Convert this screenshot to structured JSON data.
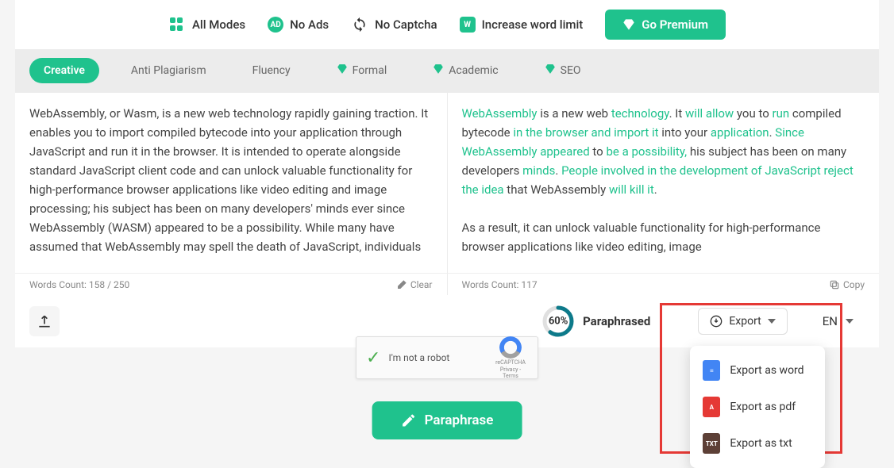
{
  "topbar": {
    "all_modes": "All Modes",
    "no_ads": "No Ads",
    "no_captcha": "No Captcha",
    "word_limit": "Increase word limit",
    "premium": "Go Premium"
  },
  "tabs": {
    "creative": "Creative",
    "anti_plagiarism": "Anti Plagiarism",
    "fluency": "Fluency",
    "formal": "Formal",
    "academic": "Academic",
    "seo": "SEO"
  },
  "input_text": {
    "full": "WebAssembly, or Wasm, is a new web technology rapidly gaining traction. It enables you to import compiled bytecode into your application through JavaScript and run it in the browser. It is intended to operate alongside standard JavaScript client code and can unlock valuable functionality for high-performance browser applications like video editing and image processing; his subject has been on many developers' minds ever since WebAssembly (WASM) appeared to be a possibility. While many have assumed that WebAssembly may spell the death of JavaScript, individuals"
  },
  "output_text": {
    "p1_seg1": "WebAssembly",
    "p1_seg2": " is a new web ",
    "p1_seg3": "technology",
    "p1_seg4": ". It ",
    "p1_seg5": "will allow",
    "p1_seg6": " you to ",
    "p1_seg7": "run",
    "p1_seg8": " compiled bytecode ",
    "p1_seg9": "in the browser and import it",
    "p1_seg10": " into your ",
    "p1_seg11": "application",
    "p1_seg12": ". ",
    "p1_seg13": "Since WebAssembly appeared",
    "p1_seg14": " to ",
    "p1_seg15": "be a possibility,",
    "p1_seg16": " his subject has been on many developers ",
    "p1_seg17": "minds",
    "p1_seg18": ". ",
    "p1_seg19": "People involved in the development of JavaScript reject the idea",
    "p1_seg20": " that WebAssembly ",
    "p1_seg21": "will kill it",
    "p1_seg22": ".",
    "p2": "As a result, it can unlock valuable functionality for high-performance browser applications like video editing, image"
  },
  "footer": {
    "input_count": "Words Count: 158 / 250",
    "output_count": "Words Count: 117",
    "clear": "Clear",
    "copy": "Copy"
  },
  "bottom": {
    "progress": "60%",
    "paraphrased": "Paraphrased",
    "export": "Export",
    "export_word": "Export as word",
    "export_pdf": "Export as pdf",
    "export_txt": "Export as txt",
    "lang": "EN"
  },
  "recaptcha": {
    "label": "I'm not a robot",
    "brand": "reCAPTCHA",
    "terms": "Privacy - Terms"
  },
  "main_action": "Paraphrase",
  "colors": {
    "accent": "#1fc28d"
  }
}
